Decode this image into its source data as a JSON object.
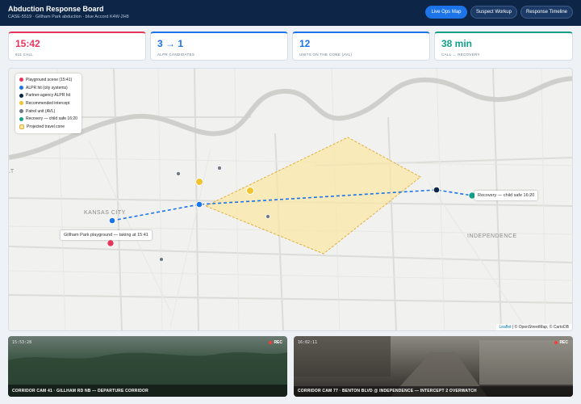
{
  "header": {
    "title": "Abduction Response Board",
    "subtitle": "CASE-5519 · Gillham Park abduction · blue Accord K4W-2H8",
    "buttons": [
      "Live Ops Map",
      "Suspect Workup",
      "Response Timeline"
    ],
    "active_button": "Live Ops Map"
  },
  "kpis": [
    {
      "value": "15:42",
      "label": "911 CALL",
      "color": "#e8355e"
    },
    {
      "value": "3 → 1",
      "label": "ALPR CANDIDATES",
      "color": "#1d74e8"
    },
    {
      "value": "12",
      "label": "UNITS ON THE CONE (AVL)",
      "color": "#1d74e8"
    },
    {
      "value": "38 min",
      "label": "CALL → RECOVERY",
      "color": "#12a089"
    }
  ],
  "map": {
    "legend": [
      {
        "label": "Playground scene (15:41)",
        "color": "#e8355e"
      },
      {
        "label": "ALPR hit (city systems)",
        "color": "#1d74e8"
      },
      {
        "label": "Partner-agency ALPR hit",
        "color": "#0d2547"
      },
      {
        "label": "Recommended intercept",
        "color": "#f0c330"
      },
      {
        "label": "Patrol unit (AVL)",
        "color": "#707a88"
      },
      {
        "label": "Recovery — child safe 16:20",
        "color": "#12a089"
      },
      {
        "label": "Projected travel cone",
        "color": "#fbe7a8"
      }
    ],
    "places": [
      "KANSAS CITY",
      "INDEPENDENCE",
      "LT"
    ],
    "popups": {
      "scene": "Gillham Park playground — taking at 15:41",
      "recovery": "Recovery — child safe 16:20"
    },
    "attribution": {
      "leaflet": "Leaflet",
      "rest": " | © OpenStreetMap, © CartoDB"
    }
  },
  "cameras": [
    {
      "timestamp": "15:53:28",
      "rec": "REC",
      "caption": "CORRIDOR CAM 41 · GILLHAM RD NB — DEPARTURE CORRIDOR"
    },
    {
      "timestamp": "16:02:11",
      "rec": "REC",
      "caption": "CORRIDOR CAM 77 · BENTON BLVD @ INDEPENDENCE — INTERCEPT 2 OVERWATCH"
    }
  ]
}
